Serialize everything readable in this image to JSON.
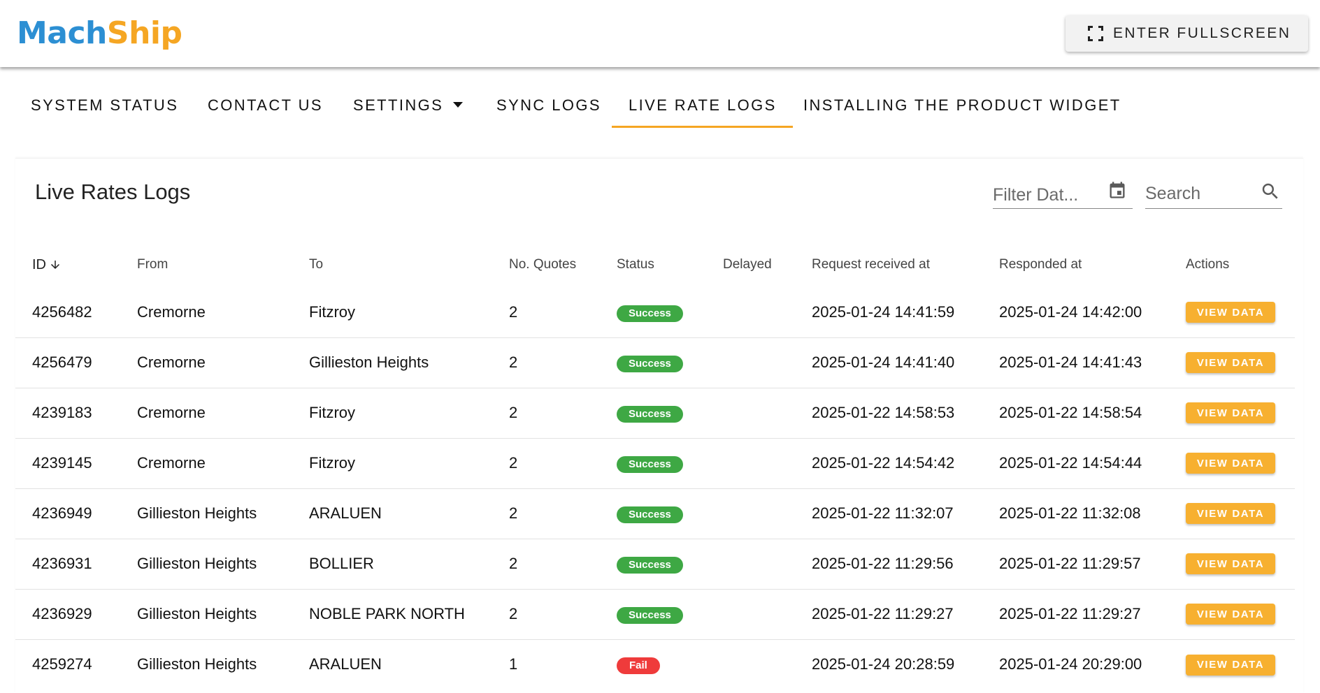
{
  "header": {
    "logo_part1": "Mach",
    "logo_part2": "Ship",
    "fullscreen_label": "ENTER FULLSCREEN"
  },
  "nav": {
    "items": [
      {
        "label": "SYSTEM STATUS"
      },
      {
        "label": "CONTACT US"
      },
      {
        "label": "SETTINGS"
      },
      {
        "label": "SYNC LOGS"
      },
      {
        "label": "LIVE RATE LOGS",
        "active": true
      },
      {
        "label": "INSTALLING THE PRODUCT WIDGET"
      }
    ]
  },
  "page": {
    "title": "Live Rates Logs",
    "filter_date_placeholder": "Filter Dat...",
    "search_placeholder": "Search"
  },
  "table": {
    "columns": [
      "ID",
      "From",
      "To",
      "No. Quotes",
      "Status",
      "Delayed",
      "Request received at",
      "Responded at",
      "Actions"
    ],
    "action_label": "VIEW DATA",
    "rows": [
      {
        "id": "4256482",
        "from": "Cremorne",
        "to": "Fitzroy",
        "quotes": "2",
        "status": "Success",
        "delayed": "",
        "received": "2025-01-24 14:41:59",
        "responded": "2025-01-24 14:42:00"
      },
      {
        "id": "4256479",
        "from": "Cremorne",
        "to": "Gillieston Heights",
        "quotes": "2",
        "status": "Success",
        "delayed": "",
        "received": "2025-01-24 14:41:40",
        "responded": "2025-01-24 14:41:43"
      },
      {
        "id": "4239183",
        "from": "Cremorne",
        "to": "Fitzroy",
        "quotes": "2",
        "status": "Success",
        "delayed": "",
        "received": "2025-01-22 14:58:53",
        "responded": "2025-01-22 14:58:54"
      },
      {
        "id": "4239145",
        "from": "Cremorne",
        "to": "Fitzroy",
        "quotes": "2",
        "status": "Success",
        "delayed": "",
        "received": "2025-01-22 14:54:42",
        "responded": "2025-01-22 14:54:44"
      },
      {
        "id": "4236949",
        "from": "Gillieston Heights",
        "to": "ARALUEN",
        "quotes": "2",
        "status": "Success",
        "delayed": "",
        "received": "2025-01-22 11:32:07",
        "responded": "2025-01-22 11:32:08"
      },
      {
        "id": "4236931",
        "from": "Gillieston Heights",
        "to": "BOLLIER",
        "quotes": "2",
        "status": "Success",
        "delayed": "",
        "received": "2025-01-22 11:29:56",
        "responded": "2025-01-22 11:29:57"
      },
      {
        "id": "4236929",
        "from": "Gillieston Heights",
        "to": "NOBLE PARK NORTH",
        "quotes": "2",
        "status": "Success",
        "delayed": "",
        "received": "2025-01-22 11:29:27",
        "responded": "2025-01-22 11:29:27"
      },
      {
        "id": "4259274",
        "from": "Gillieston Heights",
        "to": "ARALUEN",
        "quotes": "1",
        "status": "Fail",
        "delayed": "",
        "received": "2025-01-24 20:28:59",
        "responded": "2025-01-24 20:29:00"
      }
    ]
  },
  "colors": {
    "brand_blue": "#2c8fd3",
    "brand_orange": "#f5a623",
    "success": "#3ea844",
    "fail": "#ef3b3b"
  }
}
